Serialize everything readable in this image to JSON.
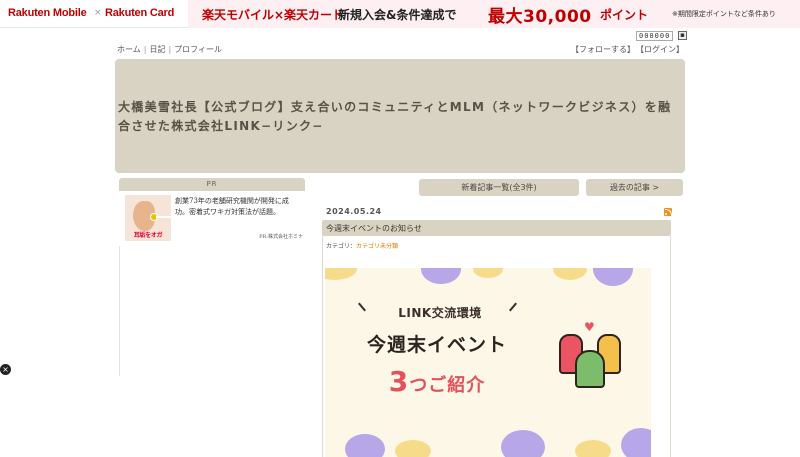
{
  "banner": {
    "brand1": "Rakuten Mobile",
    "times": "×",
    "brand2": "Rakuten Card",
    "promo_prefix": "楽天モバイル×楽天カード",
    "promo_mid": "新規入会&条件達成で",
    "promo_amount": "最大30,000",
    "promo_suffix": "ポイント",
    "promo_note": "※期間限定ポイントなど条件あり",
    "colors": {
      "brand_red": "#bf0000",
      "promo_bg": "#fdeff2"
    }
  },
  "counter": {
    "value": "000000",
    "icon": "counter-icon"
  },
  "topnav": {
    "home": "ホーム",
    "diary": "日記",
    "profile": "プロフィール",
    "separator": "|"
  },
  "usernav": {
    "follow": "【フォローする】",
    "login": "【ログイン】"
  },
  "header": {
    "title": "大橋美雪社長【公式ブログ】支え合いのコミュニティとMLM（ネットワークビジネス）を融合させた株式会社LINK−リンク−",
    "bg_color": "#d8d3c3"
  },
  "sidebar": {
    "pr": {
      "heading": "PR",
      "image_label": "耳垢をオガ",
      "text": "創業73年の老舗研究機関が開発に成功。密着式ワキガ対策法が話題。",
      "source": "PR:株式会社ホミナ"
    }
  },
  "buttons": {
    "new_entries": "新着記事一覧(全3件)",
    "past_entries": "過去の記事 >"
  },
  "entry": {
    "date": "2024.05.24",
    "rss_icon": "rss-icon",
    "title": "今週末イベントのお知らせ",
    "category_label": "カテゴリ：",
    "category": "カテゴリ未分類",
    "eyecatch": {
      "tag": "LINK交流環境",
      "headline": "今週末イベント",
      "sub_number": "3",
      "sub_text": "つご紹介",
      "colors": {
        "bg": "#fdf7e8",
        "accent_red": "#e3515d",
        "purple": "#b7a6e8",
        "yellow": "#f6dc8a"
      }
    }
  },
  "close_icon": "×"
}
